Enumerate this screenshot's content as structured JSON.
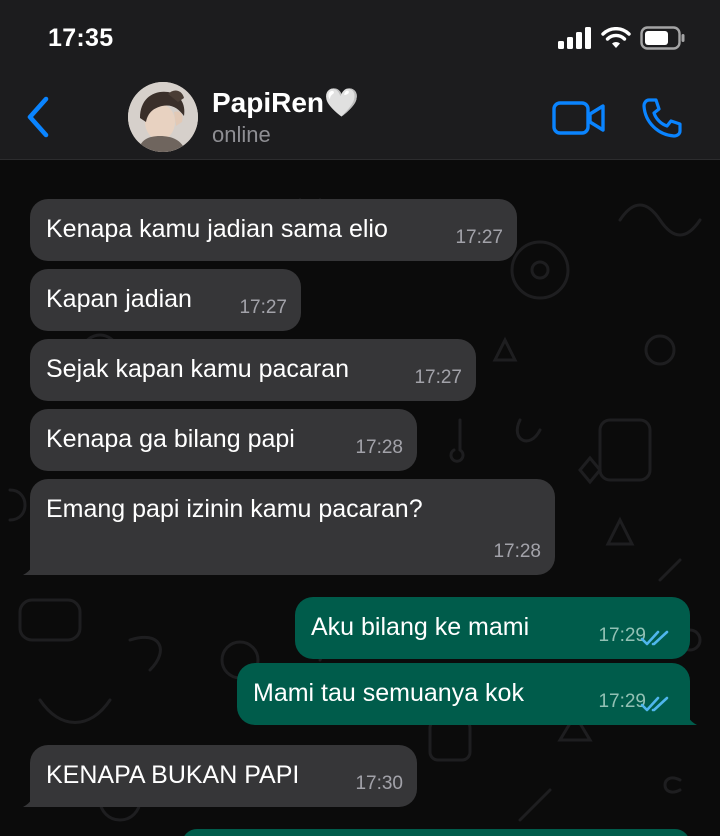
{
  "status_bar": {
    "time": "17:35"
  },
  "header": {
    "contact_name": "PapiRen🤍",
    "contact_status": "online"
  },
  "messages": [
    {
      "direction": "in",
      "text": "Kenapa kamu jadian sama elio",
      "time": "17:27"
    },
    {
      "direction": "in",
      "text": "Kapan jadian",
      "time": "17:27"
    },
    {
      "direction": "in",
      "text": "Sejak kapan kamu pacaran",
      "time": "17:27"
    },
    {
      "direction": "in",
      "text": "Kenapa ga bilang papi",
      "time": "17:28"
    },
    {
      "direction": "in",
      "text": "Emang papi izinin kamu pacaran?",
      "time": "17:28"
    },
    {
      "direction": "out",
      "text": "Aku bilang ke mami",
      "time": "17:29",
      "status": "read"
    },
    {
      "direction": "out",
      "text": "Mami tau semuanya kok",
      "time": "17:29",
      "status": "read"
    },
    {
      "direction": "in",
      "text": "KENAPA BUKAN PAPI",
      "time": "17:30"
    }
  ],
  "colors": {
    "accent": "#0a84ff",
    "incoming_bubble": "#363638",
    "outgoing_bubble": "#005c4b",
    "read_ticks": "#4fb6ec"
  }
}
